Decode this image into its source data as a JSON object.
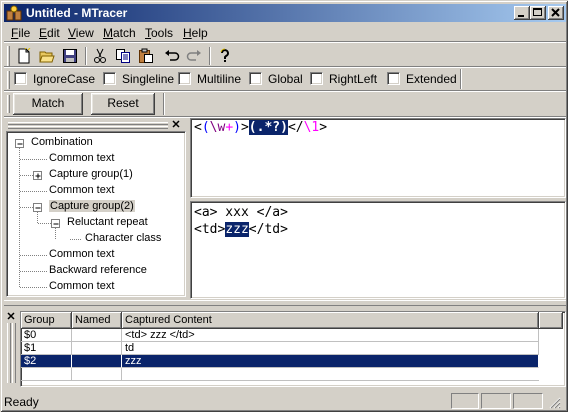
{
  "window": {
    "title": "Untitled - MTracer"
  },
  "menu": [
    {
      "label": "File",
      "mnemonic": "F",
      "rest": "ile"
    },
    {
      "label": "Edit",
      "mnemonic": "E",
      "rest": "dit"
    },
    {
      "label": "View",
      "mnemonic": "V",
      "rest": "iew"
    },
    {
      "label": "Match",
      "mnemonic": "M",
      "rest": "atch"
    },
    {
      "label": "Tools",
      "mnemonic": "T",
      "rest": "ools"
    },
    {
      "label": "Help",
      "mnemonic": "H",
      "rest": "elp"
    }
  ],
  "toolbar": {
    "icons": [
      "new-file-icon",
      "open-folder-icon",
      "save-icon",
      "cut-icon",
      "copy-icon",
      "paste-icon",
      "undo-icon",
      "redo-icon",
      "about-icon"
    ]
  },
  "options": [
    {
      "label": "IgnoreCase",
      "checked": false
    },
    {
      "label": "Singleline",
      "checked": false
    },
    {
      "label": "Multiline",
      "checked": false
    },
    {
      "label": "Global",
      "checked": false
    },
    {
      "label": "RightLeft",
      "checked": false
    },
    {
      "label": "Extended",
      "checked": false
    }
  ],
  "actions": {
    "match_label": "Match",
    "reset_label": "Reset"
  },
  "tree": {
    "nodes": [
      {
        "label": "Combination",
        "level": 0,
        "expander": "minus"
      },
      {
        "label": "Common text",
        "level": 1,
        "expander": "none"
      },
      {
        "label": "Capture group(1)",
        "level": 1,
        "expander": "plus"
      },
      {
        "label": "Common text",
        "level": 1,
        "expander": "none"
      },
      {
        "label": "Capture group(2)",
        "level": 1,
        "expander": "minus",
        "selected": true
      },
      {
        "label": "Reluctant repeat",
        "level": 2,
        "expander": "minus"
      },
      {
        "label": "Character class",
        "level": 3,
        "expander": "none"
      },
      {
        "label": "Common text",
        "level": 1,
        "expander": "none"
      },
      {
        "label": "Backward reference",
        "level": 1,
        "expander": "none"
      },
      {
        "label": "Common text",
        "level": 1,
        "expander": "none"
      }
    ]
  },
  "regex": {
    "tokens": [
      {
        "text": "<",
        "color": "#000000"
      },
      {
        "text": "(",
        "color": "#0000ff"
      },
      {
        "text": "\\w",
        "color": "#800080"
      },
      {
        "text": "+",
        "color": "#ff00ff"
      },
      {
        "text": ")",
        "color": "#0000ff"
      },
      {
        "text": ">",
        "color": "#000000"
      },
      {
        "text": "(.*?)",
        "color": "#ffffff",
        "highlight": "#0a246a"
      },
      {
        "text": "</",
        "color": "#000000"
      },
      {
        "text": "\\1",
        "color": "#ff00ff"
      },
      {
        "text": ">",
        "color": "#000000"
      }
    ]
  },
  "input_text": {
    "line1": "<a> xxx </a>",
    "line2_before": "<td>",
    "line2_match": "zzz",
    "line2_after": "</td>",
    "highlight_color": "#0a246a"
  },
  "results": {
    "columns": [
      "Group",
      "Named",
      "Captured Content"
    ],
    "rows": [
      {
        "group": "$0",
        "named": "",
        "content": "<td> zzz </td>",
        "selected": false
      },
      {
        "group": "$1",
        "named": "",
        "content": "td",
        "selected": false
      },
      {
        "group": "$2",
        "named": "",
        "content": "zzz",
        "selected": true
      }
    ]
  },
  "status": {
    "text": "Ready"
  },
  "colors": {
    "titlebar_start": "#0a246a",
    "titlebar_end": "#a6caf0",
    "selection": "#0a246a",
    "face": "#d4d0c8"
  }
}
